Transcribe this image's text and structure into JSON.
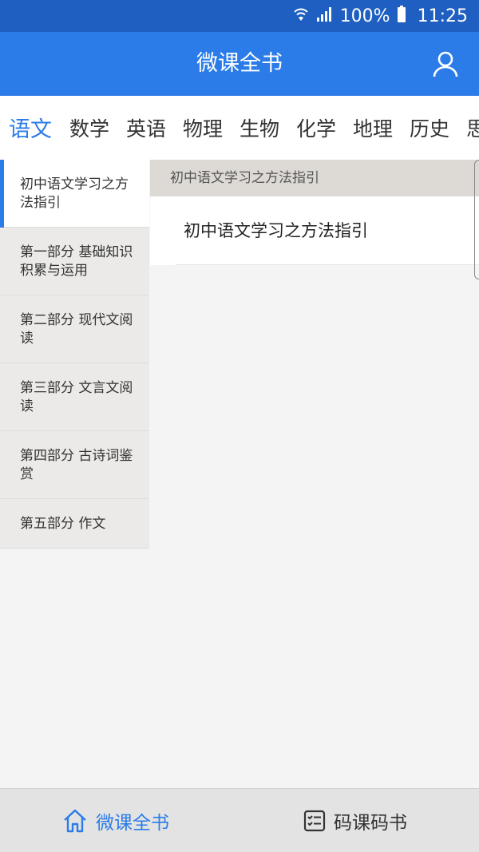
{
  "status": {
    "battery": "100%",
    "time": "11:25"
  },
  "appbar": {
    "title": "微课全书"
  },
  "tabs": [
    {
      "label": "语文"
    },
    {
      "label": "数学"
    },
    {
      "label": "英语"
    },
    {
      "label": "物理"
    },
    {
      "label": "生物"
    },
    {
      "label": "化学"
    },
    {
      "label": "地理"
    },
    {
      "label": "历史"
    },
    {
      "label": "思"
    }
  ],
  "menu": [
    {
      "label": "初中语文学习之方法指引"
    },
    {
      "label": "第一部分 基础知识积累与运用"
    },
    {
      "label": "第二部分 现代文阅读"
    },
    {
      "label": "第三部分 文言文阅读"
    },
    {
      "label": "第四部分  古诗词鉴赏"
    },
    {
      "label": "第五部分 作文"
    }
  ],
  "content": {
    "header": "初中语文学习之方法指引",
    "items": [
      {
        "title": "初中语文学习之方法指引"
      }
    ]
  },
  "bottom_nav": {
    "home_label": "微课全书",
    "code_label": "码课码书"
  },
  "colors": {
    "accent": "#2b7ce8",
    "statusbar": "#1f5fc1"
  }
}
